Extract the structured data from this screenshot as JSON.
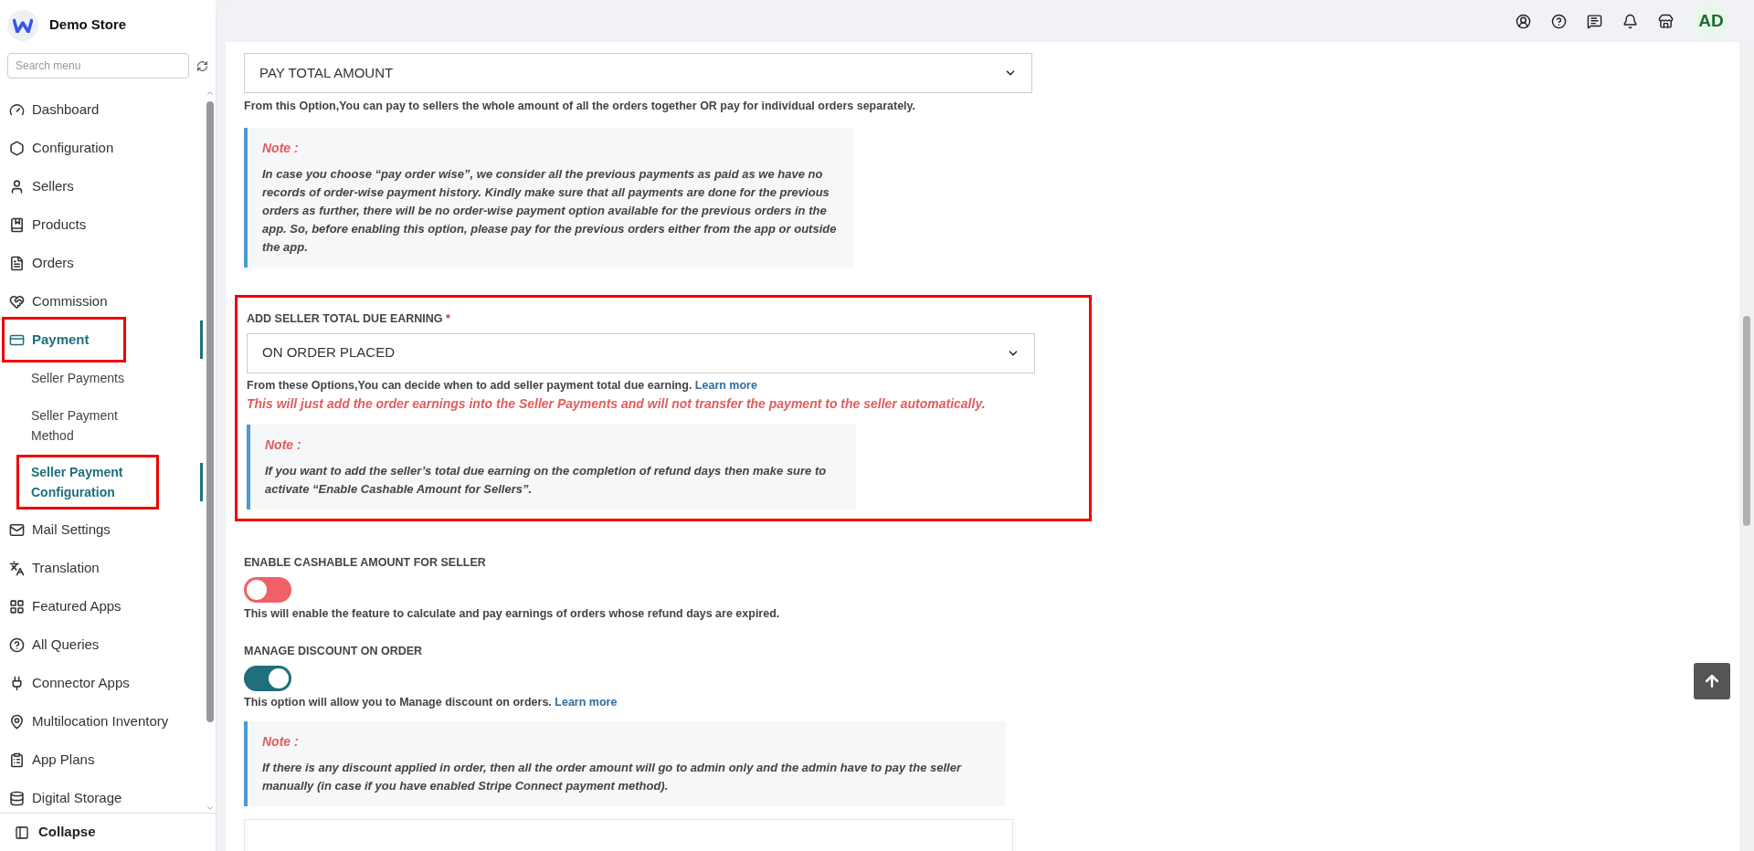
{
  "sidebar": {
    "store_name": "Demo Store",
    "search": {
      "placeholder": "Search menu"
    },
    "items": [
      {
        "label": "Dashboard",
        "selected": false,
        "highlighted": false
      },
      {
        "label": "Configuration",
        "selected": false,
        "highlighted": false
      },
      {
        "label": "Sellers",
        "selected": false,
        "highlighted": false
      },
      {
        "label": "Products",
        "selected": false,
        "highlighted": false
      },
      {
        "label": "Orders",
        "selected": false,
        "highlighted": false
      },
      {
        "label": "Commission",
        "selected": false,
        "highlighted": false
      },
      {
        "label": "Payment",
        "selected": true,
        "highlighted": true,
        "children": [
          {
            "label": "Seller Payments",
            "selected": false,
            "highlighted": false
          },
          {
            "label": "Seller Payment Method",
            "selected": false,
            "highlighted": false
          },
          {
            "label": "Seller Payment Configuration",
            "selected": true,
            "highlighted": true
          }
        ]
      },
      {
        "label": "Mail Settings",
        "selected": false,
        "highlighted": false
      },
      {
        "label": "Translation",
        "selected": false,
        "highlighted": false
      },
      {
        "label": "Featured Apps",
        "selected": false,
        "highlighted": false
      },
      {
        "label": "All Queries",
        "selected": false,
        "highlighted": false
      },
      {
        "label": "Connector Apps",
        "selected": false,
        "highlighted": false
      },
      {
        "label": "Multilocation Inventory",
        "selected": false,
        "highlighted": false
      },
      {
        "label": "App Plans",
        "selected": false,
        "highlighted": false
      },
      {
        "label": "Digital Storage",
        "selected": false,
        "highlighted": false
      }
    ],
    "collapse": "Collapse"
  },
  "header": {
    "avatar": "AD"
  },
  "payment_option": {
    "value": "PAY TOTAL AMOUNT",
    "help": "From this Option,You can pay to sellers the whole amount of all the orders together OR pay for individual orders separately.",
    "note": {
      "title": "Note :",
      "text": "In case you choose “pay order wise”, we consider all the previous payments as paid as we have no records of order-wise payment history. Kindly make sure that all payments are done for the previous orders as further, there will be no order-wise payment option available for the previous orders in the app. So, before enabling this option, please pay for the previous orders either from the app or outside the app."
    }
  },
  "due_earning": {
    "label": "ADD SELLER TOTAL DUE EARNING",
    "required_mark": "*",
    "highlighted": true,
    "value": "ON ORDER PLACED",
    "help": "From these Options,You can decide when to add seller payment total due earning.",
    "link": "Learn more",
    "warning": "This will just add the order earnings into the Seller Payments and will not transfer the payment to the seller automatically.",
    "note": {
      "title": "Note :",
      "text": "If you want to add the seller’s total due earning on the completion of refund days then make sure to activate “Enable Cashable Amount for Sellers”."
    }
  },
  "cashable": {
    "label": "ENABLE CASHABLE AMOUNT FOR SELLER",
    "on": false,
    "help": "This will enable the feature to calculate and pay earnings of orders whose refund days are expired."
  },
  "discount": {
    "label": "MANAGE DISCOUNT ON ORDER",
    "on": true,
    "help": "This option will allow you to Manage discount on orders.",
    "link": "Learn more",
    "note": {
      "title": "Note :",
      "text": "If there is any discount applied in order, then all the order amount will go to admin only and the admin have to pay the seller manually (in case if you have enabled Stripe Connect payment method)."
    }
  }
}
